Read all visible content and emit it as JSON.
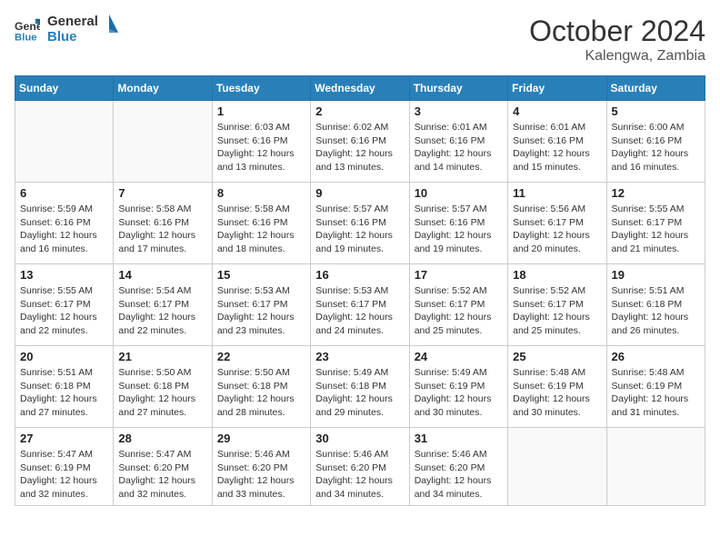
{
  "header": {
    "logo_line1": "General",
    "logo_line2": "Blue",
    "month": "October 2024",
    "location": "Kalengwa, Zambia"
  },
  "weekdays": [
    "Sunday",
    "Monday",
    "Tuesday",
    "Wednesday",
    "Thursday",
    "Friday",
    "Saturday"
  ],
  "weeks": [
    [
      {
        "day": "",
        "info": ""
      },
      {
        "day": "",
        "info": ""
      },
      {
        "day": "1",
        "info": "Sunrise: 6:03 AM\nSunset: 6:16 PM\nDaylight: 12 hours and 13 minutes."
      },
      {
        "day": "2",
        "info": "Sunrise: 6:02 AM\nSunset: 6:16 PM\nDaylight: 12 hours and 13 minutes."
      },
      {
        "day": "3",
        "info": "Sunrise: 6:01 AM\nSunset: 6:16 PM\nDaylight: 12 hours and 14 minutes."
      },
      {
        "day": "4",
        "info": "Sunrise: 6:01 AM\nSunset: 6:16 PM\nDaylight: 12 hours and 15 minutes."
      },
      {
        "day": "5",
        "info": "Sunrise: 6:00 AM\nSunset: 6:16 PM\nDaylight: 12 hours and 16 minutes."
      }
    ],
    [
      {
        "day": "6",
        "info": "Sunrise: 5:59 AM\nSunset: 6:16 PM\nDaylight: 12 hours and 16 minutes."
      },
      {
        "day": "7",
        "info": "Sunrise: 5:58 AM\nSunset: 6:16 PM\nDaylight: 12 hours and 17 minutes."
      },
      {
        "day": "8",
        "info": "Sunrise: 5:58 AM\nSunset: 6:16 PM\nDaylight: 12 hours and 18 minutes."
      },
      {
        "day": "9",
        "info": "Sunrise: 5:57 AM\nSunset: 6:16 PM\nDaylight: 12 hours and 19 minutes."
      },
      {
        "day": "10",
        "info": "Sunrise: 5:57 AM\nSunset: 6:16 PM\nDaylight: 12 hours and 19 minutes."
      },
      {
        "day": "11",
        "info": "Sunrise: 5:56 AM\nSunset: 6:17 PM\nDaylight: 12 hours and 20 minutes."
      },
      {
        "day": "12",
        "info": "Sunrise: 5:55 AM\nSunset: 6:17 PM\nDaylight: 12 hours and 21 minutes."
      }
    ],
    [
      {
        "day": "13",
        "info": "Sunrise: 5:55 AM\nSunset: 6:17 PM\nDaylight: 12 hours and 22 minutes."
      },
      {
        "day": "14",
        "info": "Sunrise: 5:54 AM\nSunset: 6:17 PM\nDaylight: 12 hours and 22 minutes."
      },
      {
        "day": "15",
        "info": "Sunrise: 5:53 AM\nSunset: 6:17 PM\nDaylight: 12 hours and 23 minutes."
      },
      {
        "day": "16",
        "info": "Sunrise: 5:53 AM\nSunset: 6:17 PM\nDaylight: 12 hours and 24 minutes."
      },
      {
        "day": "17",
        "info": "Sunrise: 5:52 AM\nSunset: 6:17 PM\nDaylight: 12 hours and 25 minutes."
      },
      {
        "day": "18",
        "info": "Sunrise: 5:52 AM\nSunset: 6:17 PM\nDaylight: 12 hours and 25 minutes."
      },
      {
        "day": "19",
        "info": "Sunrise: 5:51 AM\nSunset: 6:18 PM\nDaylight: 12 hours and 26 minutes."
      }
    ],
    [
      {
        "day": "20",
        "info": "Sunrise: 5:51 AM\nSunset: 6:18 PM\nDaylight: 12 hours and 27 minutes."
      },
      {
        "day": "21",
        "info": "Sunrise: 5:50 AM\nSunset: 6:18 PM\nDaylight: 12 hours and 27 minutes."
      },
      {
        "day": "22",
        "info": "Sunrise: 5:50 AM\nSunset: 6:18 PM\nDaylight: 12 hours and 28 minutes."
      },
      {
        "day": "23",
        "info": "Sunrise: 5:49 AM\nSunset: 6:18 PM\nDaylight: 12 hours and 29 minutes."
      },
      {
        "day": "24",
        "info": "Sunrise: 5:49 AM\nSunset: 6:19 PM\nDaylight: 12 hours and 30 minutes."
      },
      {
        "day": "25",
        "info": "Sunrise: 5:48 AM\nSunset: 6:19 PM\nDaylight: 12 hours and 30 minutes."
      },
      {
        "day": "26",
        "info": "Sunrise: 5:48 AM\nSunset: 6:19 PM\nDaylight: 12 hours and 31 minutes."
      }
    ],
    [
      {
        "day": "27",
        "info": "Sunrise: 5:47 AM\nSunset: 6:19 PM\nDaylight: 12 hours and 32 minutes."
      },
      {
        "day": "28",
        "info": "Sunrise: 5:47 AM\nSunset: 6:20 PM\nDaylight: 12 hours and 32 minutes."
      },
      {
        "day": "29",
        "info": "Sunrise: 5:46 AM\nSunset: 6:20 PM\nDaylight: 12 hours and 33 minutes."
      },
      {
        "day": "30",
        "info": "Sunrise: 5:46 AM\nSunset: 6:20 PM\nDaylight: 12 hours and 34 minutes."
      },
      {
        "day": "31",
        "info": "Sunrise: 5:46 AM\nSunset: 6:20 PM\nDaylight: 12 hours and 34 minutes."
      },
      {
        "day": "",
        "info": ""
      },
      {
        "day": "",
        "info": ""
      }
    ]
  ]
}
